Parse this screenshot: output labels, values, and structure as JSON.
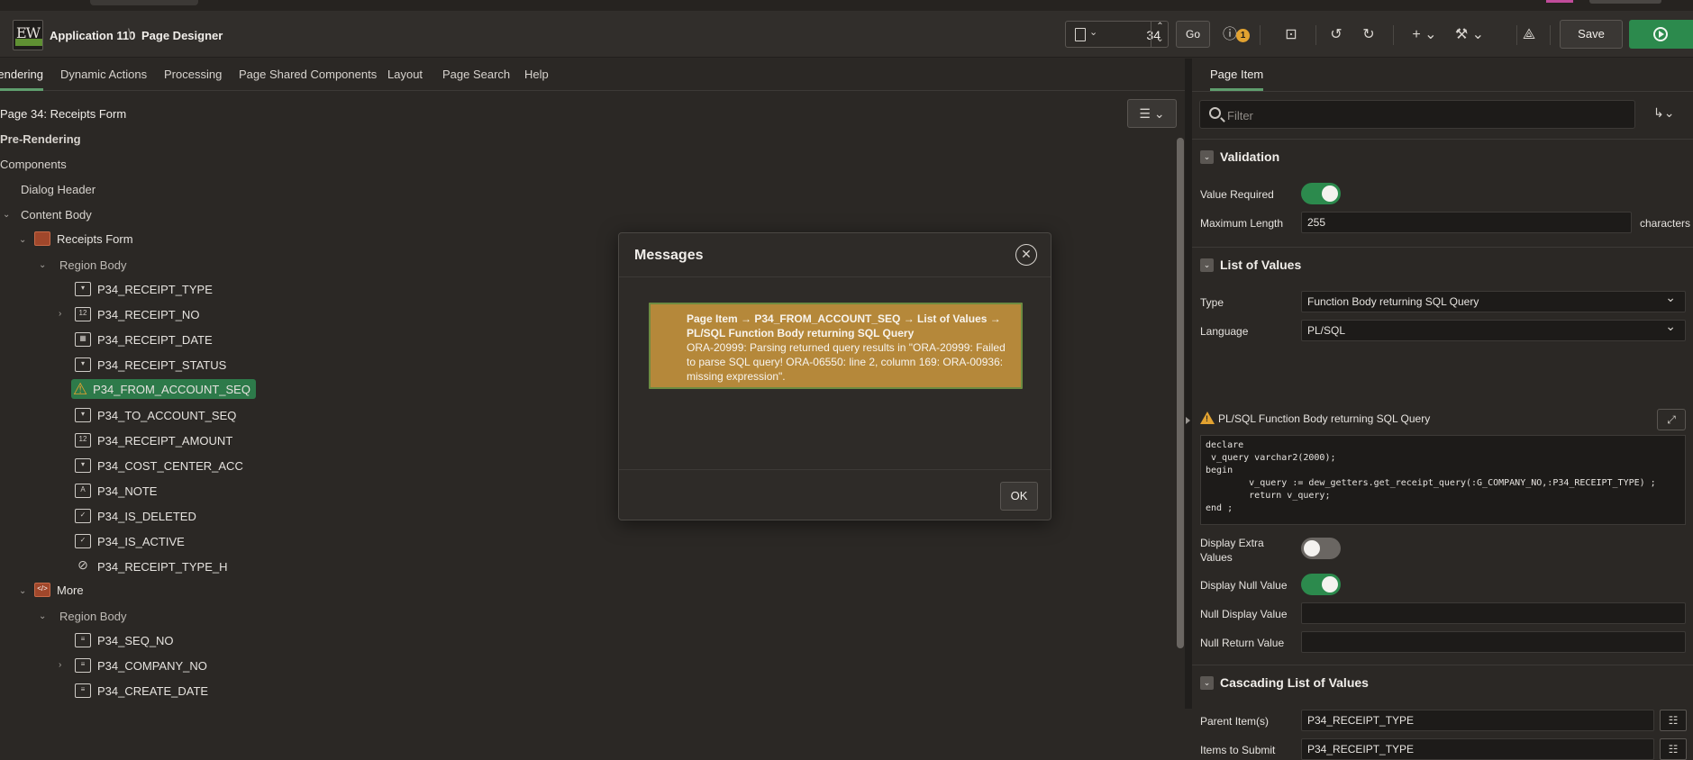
{
  "header": {
    "app_label": "Application 110",
    "separator": "\\",
    "page_label": "Page Designer",
    "page_number": "34",
    "go_label": "Go",
    "warning_count": "1",
    "save_label": "Save"
  },
  "left": {
    "tabs": [
      "Rendering",
      "Dynamic Actions",
      "Processing",
      "Page Shared Components",
      "Layout",
      "Page Search",
      "Help"
    ],
    "tree": {
      "page_title": "Page 34: Receipts Form",
      "pre_rendering": "Pre-Rendering",
      "components": "Components",
      "dialog_header": "Dialog Header",
      "content_body": "Content Body",
      "region1": "Receipts Form",
      "region1_body": "Region Body",
      "items1": [
        "P34_RECEIPT_TYPE",
        "P34_RECEIPT_NO",
        "P34_RECEIPT_DATE",
        "P34_RECEIPT_STATUS",
        "P34_FROM_ACCOUNT_SEQ",
        "P34_TO_ACCOUNT_SEQ",
        "P34_RECEIPT_AMOUNT",
        "P34_COST_CENTER_ACC",
        "P34_NOTE",
        "P34_IS_DELETED",
        "P34_IS_ACTIVE",
        "P34_RECEIPT_TYPE_H"
      ],
      "region2": "More",
      "region2_body": "Region Body",
      "items2": [
        "P34_SEQ_NO",
        "P34_COMPANY_NO",
        "P34_CREATE_DATE"
      ]
    }
  },
  "right": {
    "tab": "Page Item",
    "filter_placeholder": "Filter",
    "validation": {
      "title": "Validation",
      "value_required_label": "Value Required",
      "max_length_label": "Maximum Length",
      "max_length_value": "255",
      "max_length_unit": "characters"
    },
    "lov": {
      "title": "List of Values",
      "type_label": "Type",
      "type_value": "Function Body returning SQL Query",
      "language_label": "Language",
      "language_value": "PL/SQL",
      "code_label": "PL/SQL Function Body returning SQL Query",
      "code": "declare\n v_query varchar2(2000);\nbegin\n        v_query := dew_getters.get_receipt_query(:G_COMPANY_NO,:P34_RECEIPT_TYPE) ;\n        return v_query;\nend ;",
      "display_extra_label": "Display Extra Values",
      "display_null_label": "Display Null Value",
      "null_display_label": "Null Display Value",
      "null_display_value": "",
      "null_return_label": "Null Return Value",
      "null_return_value": ""
    },
    "cascading": {
      "title": "Cascading List of Values",
      "parent_label": "Parent Item(s)",
      "parent_value": "P34_RECEIPT_TYPE",
      "submit_label": "Items to Submit",
      "submit_value": "P34_RECEIPT_TYPE"
    }
  },
  "dialog": {
    "title": "Messages",
    "path": "Page Item → P34_FROM_ACCOUNT_SEQ → List of Values → PL/SQL Function Body returning SQL Query",
    "message": "ORA-20999: Parsing returned query results in \"ORA-20999: Failed to parse SQL query! ORA-06550: line 2, column 169: ORA-00936: missing expression\".",
    "ok_label": "OK"
  },
  "colors": {
    "accent_green": "#2c8a4d",
    "warning": "#e2a230",
    "alert_bg": "#b5883a"
  }
}
